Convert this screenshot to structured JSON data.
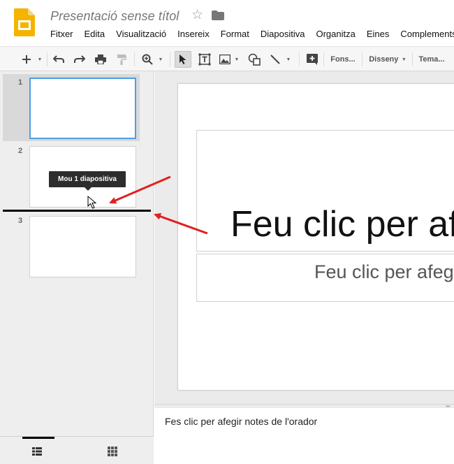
{
  "app": {
    "name": "Google Slides",
    "brand_color": "#F4B400"
  },
  "document": {
    "title": "Presentació sense títol"
  },
  "header_icons": [
    "star-icon",
    "folder-icon"
  ],
  "menu": [
    "Fitxer",
    "Edita",
    "Visualització",
    "Insereix",
    "Format",
    "Diapositiva",
    "Organitza",
    "Eines",
    "Complements"
  ],
  "toolbar": {
    "icons": [
      "new-slide-icon",
      "undo-icon",
      "redo-icon",
      "print-icon",
      "paint-format-icon",
      "zoom-icon",
      "select-icon",
      "text-box-icon",
      "image-icon",
      "shape-icon",
      "line-icon",
      "comment-icon"
    ],
    "background_label": "Fons...",
    "layout_label": "Disseny",
    "theme_label": "Tema..."
  },
  "slides": [
    {
      "number": "1",
      "selected": true
    },
    {
      "number": "2",
      "selected": false
    },
    {
      "number": "3",
      "selected": false
    }
  ],
  "drag_tooltip": "Mou 1 diapositiva",
  "slide_canvas": {
    "title_placeholder": "Feu clic per afegir un títol",
    "subtitle_placeholder": "Feu clic per afegir un subtítol"
  },
  "notes": {
    "placeholder": "Fes clic per afegir notes de l'orador"
  },
  "annotation_color": "#E02020"
}
